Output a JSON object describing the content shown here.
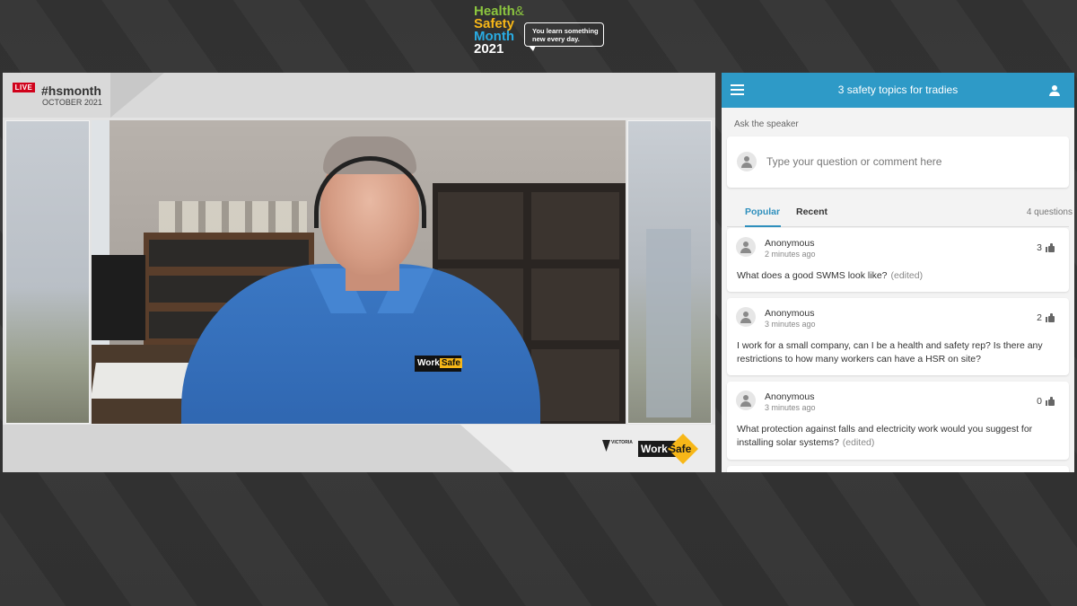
{
  "branding": {
    "line1": "Health",
    "amp": "&",
    "line2": "Safety",
    "line3": "Month",
    "line4": "2021",
    "tagline": "You learn something new every day."
  },
  "video": {
    "live_badge": "LIVE",
    "hashtag": "#hsmonth",
    "month": "OCTOBER 2021",
    "shirt_logo_work": "Work",
    "shirt_logo_safe": "Safe",
    "vic_logo_text": "VICTORIA",
    "worksafe_logo_work": "Work",
    "worksafe_logo_safe": "Safe"
  },
  "qa": {
    "header_title": "3 safety topics for tradies",
    "ask_label": "Ask the speaker",
    "input_placeholder": "Type your question or comment here",
    "tabs": [
      "Popular",
      "Recent"
    ],
    "active_tab": "Popular",
    "question_count": "4 questions",
    "questions": [
      {
        "author": "Anonymous",
        "time": "2 minutes ago",
        "votes": "3",
        "text": "What does a good SWMS look like?",
        "edited": "(edited)"
      },
      {
        "author": "Anonymous",
        "time": "3 minutes ago",
        "votes": "2",
        "text": "I work for a small company, can I be a health and safety rep? Is there any restrictions to how many workers can have a HSR on site?",
        "edited": ""
      },
      {
        "author": "Anonymous",
        "time": "3 minutes ago",
        "votes": "0",
        "text": "What protection against falls and electricity work would you suggest for installing solar systems?",
        "edited": "(edited)"
      }
    ]
  },
  "colors": {
    "header_blue": "#2e9ac7",
    "live_red": "#d0021b",
    "worksafe_yellow": "#f7b718"
  }
}
